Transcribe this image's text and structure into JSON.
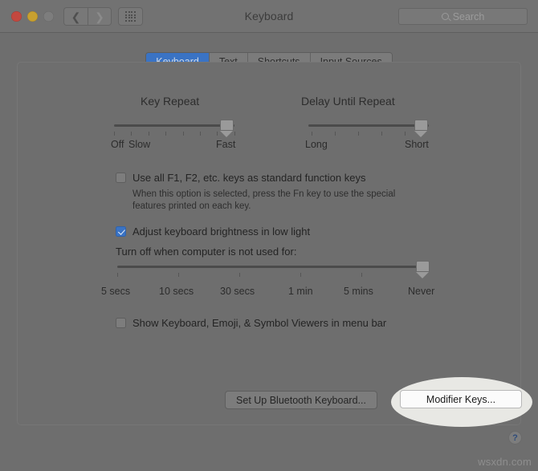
{
  "window": {
    "title": "Keyboard",
    "traffic_lights": [
      "close",
      "minimize",
      "zoom"
    ],
    "nav_back_icon": "chevron-left-icon",
    "nav_forward_icon": "chevron-right-icon",
    "grid_icon": "show-all-grid-icon"
  },
  "search": {
    "placeholder": "Search",
    "value": "",
    "icon": "search-icon"
  },
  "tabs": [
    {
      "label": "Keyboard",
      "active": true
    },
    {
      "label": "Text",
      "active": false
    },
    {
      "label": "Shortcuts",
      "active": false
    },
    {
      "label": "Input Sources",
      "active": false
    }
  ],
  "key_repeat": {
    "title": "Key Repeat",
    "min_labels": [
      "Off",
      "Slow"
    ],
    "max_label": "Fast",
    "tick_count": 8,
    "value_percent": 93
  },
  "delay_until_repeat": {
    "title": "Delay Until Repeat",
    "min_label": "Long",
    "max_label": "Short",
    "tick_count": 5,
    "value_percent": 93
  },
  "options": {
    "function_keys": {
      "label": "Use all F1, F2, etc. keys as standard function keys",
      "checked": false,
      "help_line_1": "When this option is selected, press the Fn key to use the special",
      "help_line_2": "features printed on each key."
    },
    "brightness": {
      "label": "Adjust keyboard brightness in low light",
      "checked": true
    },
    "turn_off_label": "Turn off when computer is not used for:",
    "turn_off_slider": {
      "tick_labels": [
        "5 secs",
        "10 secs",
        "30 secs",
        "1 min",
        "5 mins",
        "Never"
      ],
      "selected": "Never",
      "value_percent": 100
    },
    "viewers": {
      "label": "Show Keyboard, Emoji, & Symbol Viewers in menu bar",
      "checked": false
    }
  },
  "buttons": {
    "bluetooth": "Set Up Bluetooth Keyboard...",
    "modifier_keys": "Modifier Keys..."
  },
  "help": {
    "label": "?",
    "icon": "help-icon"
  },
  "watermark": "wsxdn.com",
  "colors": {
    "accent": "#3a73c4",
    "background": "#6e6e6e",
    "titlebar": "#727272",
    "highlight_ellipse": "#e8e8e4"
  }
}
